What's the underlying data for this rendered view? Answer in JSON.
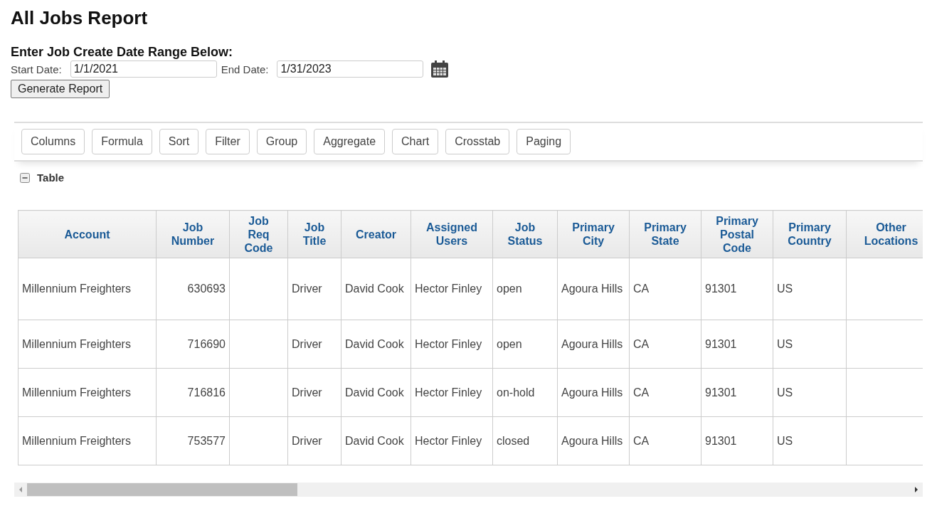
{
  "title": "All Jobs Report",
  "form": {
    "heading": "Enter Job Create Date Range Below:",
    "start_label": "Start Date:",
    "start_value": "1/1/2021",
    "end_label": "End Date:",
    "end_value": "1/31/2023",
    "button": "Generate Report"
  },
  "toolbar": [
    "Columns",
    "Formula",
    "Sort",
    "Filter",
    "Group",
    "Aggregate",
    "Chart",
    "Crosstab",
    "Paging"
  ],
  "section": {
    "label": "Table",
    "expanded": true
  },
  "table": {
    "columns": [
      {
        "label": "Account",
        "kind": "text"
      },
      {
        "label": "Job\nNumber",
        "kind": "number"
      },
      {
        "label": "Job\nReq\nCode",
        "kind": "text"
      },
      {
        "label": "Job\nTitle",
        "kind": "text"
      },
      {
        "label": "Creator",
        "kind": "text"
      },
      {
        "label": "Assigned\nUsers",
        "kind": "text"
      },
      {
        "label": "Job\nStatus",
        "kind": "text"
      },
      {
        "label": "Primary\nCity",
        "kind": "text"
      },
      {
        "label": "Primary\nState",
        "kind": "text"
      },
      {
        "label": "Primary\nPostal\nCode",
        "kind": "text"
      },
      {
        "label": "Primary\nCountry",
        "kind": "text"
      },
      {
        "label": "Other\nLocations",
        "kind": "text"
      }
    ],
    "rows": [
      [
        "Millennium Freighters",
        "630693",
        "",
        "Driver",
        "David Cook",
        "Hector Finley",
        "open",
        "Agoura Hills",
        "CA",
        "91301",
        "US",
        ""
      ],
      [
        "Millennium Freighters",
        "716690",
        "",
        "Driver",
        "David Cook",
        "Hector Finley",
        "open",
        "Agoura Hills",
        "CA",
        "91301",
        "US",
        ""
      ],
      [
        "Millennium Freighters",
        "716816",
        "",
        "Driver",
        "David Cook",
        "Hector Finley",
        "on-hold",
        "Agoura Hills",
        "CA",
        "91301",
        "US",
        ""
      ],
      [
        "Millennium Freighters",
        "753577",
        "",
        "Driver",
        "David Cook",
        "Hector Finley",
        "closed",
        "Agoura Hills",
        "CA",
        "91301",
        "US",
        ""
      ]
    ]
  }
}
